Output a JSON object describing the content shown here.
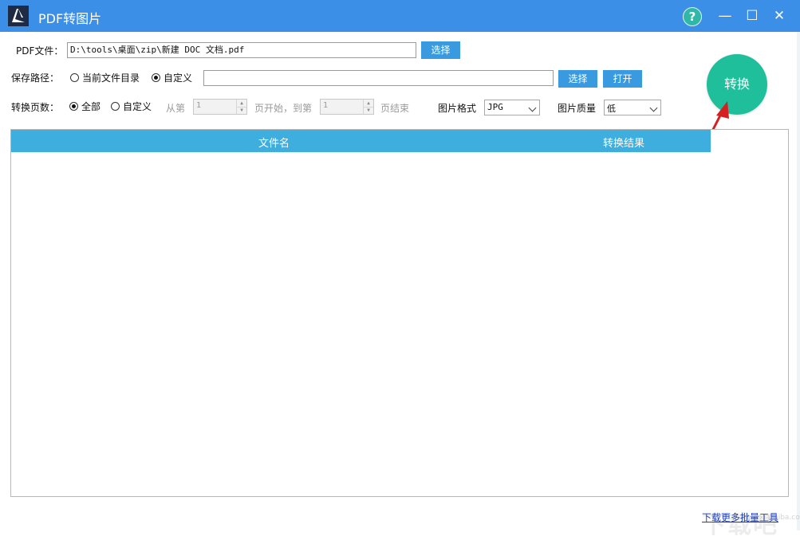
{
  "window": {
    "title": "PDF转图片",
    "help_symbol": "?",
    "minimize_symbol": "—",
    "maximize_symbol": "☐",
    "close_symbol": "✕"
  },
  "pdf_file": {
    "label": "PDF文件：",
    "value": "D:\\tools\\桌面\\zip\\新建 DOC 文档.pdf",
    "select_button": "选择"
  },
  "save_path": {
    "label": "保存路径：",
    "options": [
      {
        "label": "当前文件目录",
        "checked": false
      },
      {
        "label": "自定义",
        "checked": true
      }
    ],
    "value": "",
    "select_button": "选择",
    "open_button": "打开"
  },
  "pages": {
    "label": "转换页数：",
    "options": [
      {
        "label": "全部",
        "checked": true
      },
      {
        "label": "自定义",
        "checked": false
      }
    ],
    "from_label": "从第",
    "from_value": "1",
    "middle_label": "页开始，到第",
    "to_value": "1",
    "end_label": "页结束"
  },
  "image_format": {
    "label": "图片格式",
    "value": "JPG"
  },
  "image_quality": {
    "label": "图片质量",
    "value": "低"
  },
  "convert_button": "转换",
  "table": {
    "columns": [
      "文件名",
      "转换结果"
    ],
    "rows": []
  },
  "footer": {
    "link": "下载更多批量工具",
    "watermark": "下载吧"
  },
  "colors": {
    "titlebar": "#3b8fe6",
    "accent_button": "#3a9ae0",
    "convert": "#20bf9c",
    "table_header": "#3eaede",
    "arrow": "#d42020"
  }
}
